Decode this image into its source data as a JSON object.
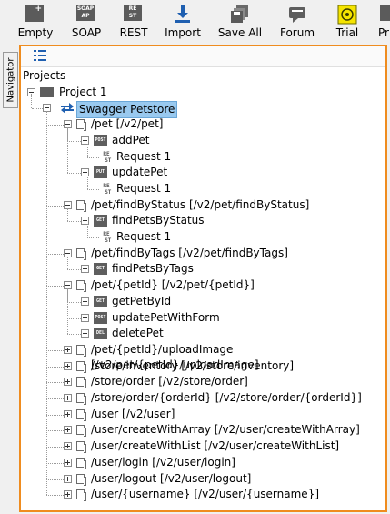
{
  "toolbar": {
    "buttons": [
      {
        "label": "Empty",
        "icon": "empty-project-icon"
      },
      {
        "label": "SOAP",
        "icon": "soap-icon"
      },
      {
        "label": "REST",
        "icon": "rest-icon"
      },
      {
        "label": "Import",
        "icon": "import-icon"
      },
      {
        "label": "Save All",
        "icon": "save-all-icon"
      },
      {
        "label": "Forum",
        "icon": "forum-icon"
      },
      {
        "label": "Trial",
        "icon": "trial-icon"
      },
      {
        "label": "Pr",
        "icon": "preferences-icon"
      }
    ]
  },
  "navigator_tab": "Navigator",
  "tree": {
    "root": "Projects",
    "project": "Project 1",
    "service": "Swagger Petstore",
    "resources": [
      {
        "label": "/pet [/v2/pet]"
      },
      {
        "label": "addPet",
        "badge": "POST"
      },
      {
        "label": "Request 1"
      },
      {
        "label": "updatePet",
        "badge": "PUT"
      },
      {
        "label": "Request 1"
      },
      {
        "label": "/pet/findByStatus [/v2/pet/findByStatus]"
      },
      {
        "label": "findPetsByStatus",
        "badge": "GET"
      },
      {
        "label": "Request 1"
      },
      {
        "label": "/pet/findByTags [/v2/pet/findByTags]"
      },
      {
        "label": "findPetsByTags",
        "badge": "GET"
      },
      {
        "label": "/pet/{petId} [/v2/pet/{petId}]"
      },
      {
        "label": "getPetById",
        "badge": "GET"
      },
      {
        "label": "updatePetWithForm",
        "badge": "POST"
      },
      {
        "label": "deletePet",
        "badge": "DEL"
      },
      {
        "label": "/pet/{petId}/uploadImage [/v2/pet/{petId}/uploadImage]"
      },
      {
        "label": "/store/inventory [/v2/store/inventory]"
      },
      {
        "label": "/store/order [/v2/store/order]"
      },
      {
        "label": "/store/order/{orderId} [/v2/store/order/{orderId}]"
      },
      {
        "label": "/user [/v2/user]"
      },
      {
        "label": "/user/createWithArray [/v2/user/createWithArray]"
      },
      {
        "label": "/user/createWithList [/v2/user/createWithList]"
      },
      {
        "label": "/user/login [/v2/user/login]"
      },
      {
        "label": "/user/logout [/v2/user/logout]"
      },
      {
        "label": "/user/{username} [/v2/user/{username}]"
      }
    ]
  },
  "colors": {
    "panel_border": "#ef8c1f",
    "selection": "#99c9ef",
    "badge": "#5e5e5e"
  }
}
